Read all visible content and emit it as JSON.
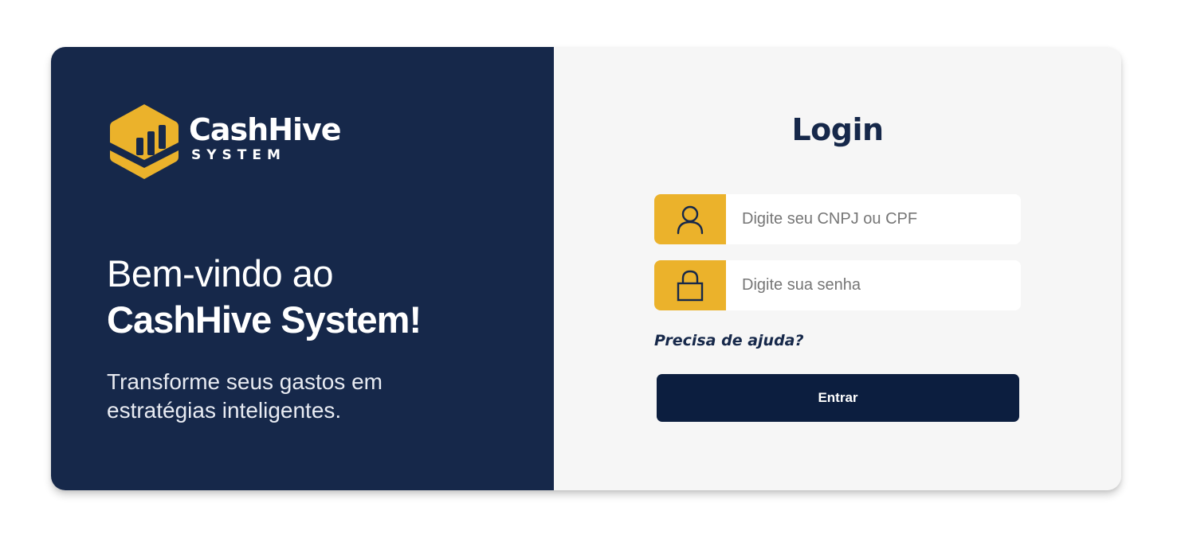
{
  "brand": {
    "name": "CashHive",
    "subtitle": "SYSTEM",
    "logo_icon": "hexagon-bar-chart-logo",
    "colors": {
      "navy": "#16284a",
      "gold": "#ebb22b",
      "button": "#0c1e3f"
    }
  },
  "welcome": {
    "line1": "Bem-vindo ao",
    "line2": "CashHive System!",
    "tagline": "Transforme seus gastos em estratégias inteligentes."
  },
  "login": {
    "title": "Login",
    "user_field": {
      "icon": "user-icon",
      "placeholder": "Digite seu CNPJ ou CPF",
      "value": ""
    },
    "password_field": {
      "icon": "lock-icon",
      "placeholder": "Digite sua senha",
      "value": ""
    },
    "help_link": "Precisa de ajuda?",
    "submit_label": "Entrar"
  }
}
